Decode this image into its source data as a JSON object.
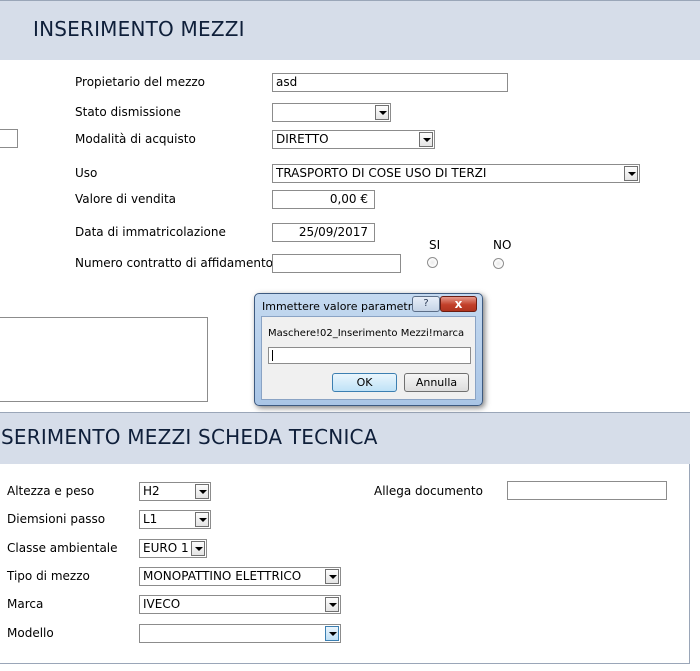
{
  "section1": {
    "title": "INSERIMENTO MEZZI",
    "fields": {
      "proprietario": {
        "label": "Propietario del mezzo",
        "value": "asd"
      },
      "stato_dismissione": {
        "label": "Stato dismissione",
        "value": ""
      },
      "modalita_acquisto": {
        "label": "Modalità di acquisto",
        "value": "DIRETTO"
      },
      "uso": {
        "label": "Uso",
        "value": "TRASPORTO DI COSE USO DI TERZI"
      },
      "valore_vendita": {
        "label": "Valore di vendita",
        "value": "0,00 €"
      },
      "data_immatricolazione": {
        "label": "Data di immatricolazione",
        "value": "25/09/2017"
      },
      "numero_contratto": {
        "label": "Numero contratto di affidamento",
        "value": ""
      }
    },
    "radio": {
      "si_label": "SI",
      "no_label": "NO"
    }
  },
  "dialog": {
    "title": "Immettere valore parametro",
    "help_label": "?",
    "close_label": "x",
    "prompt": "Maschere!02_Inserimento Mezzi!marca",
    "input_value": "",
    "ok_label": "OK",
    "cancel_label": "Annulla"
  },
  "section2": {
    "title": "SERIMENTO MEZZI SCHEDA TECNICA",
    "fields": {
      "altezza_peso": {
        "label": "Altezza e peso",
        "value": "H2"
      },
      "dimensioni_passo": {
        "label": "Diemsioni passo",
        "value": "L1"
      },
      "classe_ambientale": {
        "label": "Classe ambientale",
        "value": "EURO 1"
      },
      "tipo_mezzo": {
        "label": "Tipo di mezzo",
        "value": "MONOPATTINO ELETTRICO"
      },
      "marca": {
        "label": "Marca",
        "value": "IVECO"
      },
      "modello": {
        "label": "Modello",
        "value": ""
      },
      "allega_documento": {
        "label": "Allega documento",
        "value": ""
      }
    }
  }
}
